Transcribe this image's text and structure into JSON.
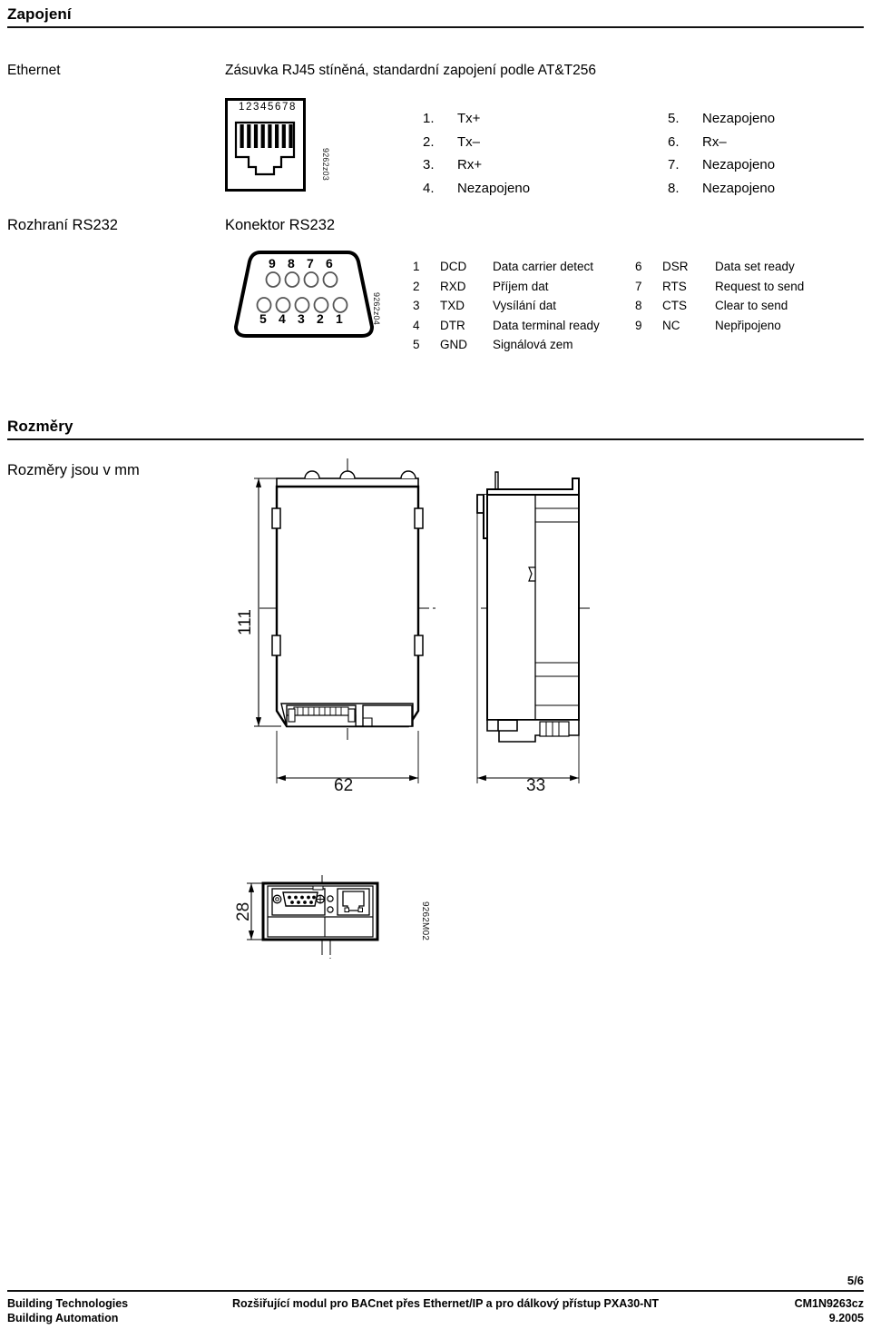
{
  "sections": {
    "wiring": {
      "heading": "Zapojení",
      "ethernet": {
        "label": "Ethernet",
        "description": "Zásuvka RJ45 stíněná, standardní zapojení podle AT&T256",
        "diagram_code": "9262z03",
        "connector_pin_header": "12345678",
        "pins_left": [
          {
            "num": "1.",
            "value": "Tx+"
          },
          {
            "num": "2.",
            "value": "Tx–"
          },
          {
            "num": "3.",
            "value": "Rx+"
          },
          {
            "num": "4.",
            "value": "Nezapojeno"
          }
        ],
        "pins_right": [
          {
            "num": "5.",
            "value": "Nezapojeno"
          },
          {
            "num": "6.",
            "value": "Rx–"
          },
          {
            "num": "7.",
            "value": "Nezapojeno"
          },
          {
            "num": "8.",
            "value": "Nezapojeno"
          }
        ]
      },
      "rs232": {
        "label": "Rozhraní RS232",
        "connector_label": "Konektor RS232",
        "diagram_code": "9262z04",
        "top_row_pins": [
          "9",
          "8",
          "7",
          "6"
        ],
        "bottom_row_pins": [
          "5",
          "4",
          "3",
          "2",
          "1"
        ],
        "pins_left": [
          {
            "pin": "1",
            "signal": "DCD",
            "desc": "Data carrier detect"
          },
          {
            "pin": "2",
            "signal": "RXD",
            "desc": "Příjem dat"
          },
          {
            "pin": "3",
            "signal": "TXD",
            "desc": "Vysílání dat"
          },
          {
            "pin": "4",
            "signal": "DTR",
            "desc": "Data terminal ready"
          },
          {
            "pin": "5",
            "signal": "GND",
            "desc": "Signálová zem"
          }
        ],
        "pins_right": [
          {
            "pin": "6",
            "signal": "DSR",
            "desc": "Data set ready"
          },
          {
            "pin": "7",
            "signal": "RTS",
            "desc": "Request to send"
          },
          {
            "pin": "8",
            "signal": "CTS",
            "desc": "Clear to send"
          },
          {
            "pin": "9",
            "signal": "NC",
            "desc": "Nepřipojeno"
          }
        ]
      }
    },
    "dimensions": {
      "heading": "Rozměry",
      "note": "Rozměry jsou v mm",
      "drawing_code": "9262M02",
      "values": {
        "height": "111",
        "width": "62",
        "depth": "33",
        "bottom_height": "28"
      }
    }
  },
  "footer": {
    "page": "5/6",
    "company_line1": "Building Technologies",
    "company_line2": "Building Automation",
    "doc_title": "Rozšiřující modul pro BACnet přes Ethernet/IP a pro dálkový přístup PXA30-NT",
    "doc_number": "CM1N9263cz",
    "doc_date": "9.2005"
  }
}
